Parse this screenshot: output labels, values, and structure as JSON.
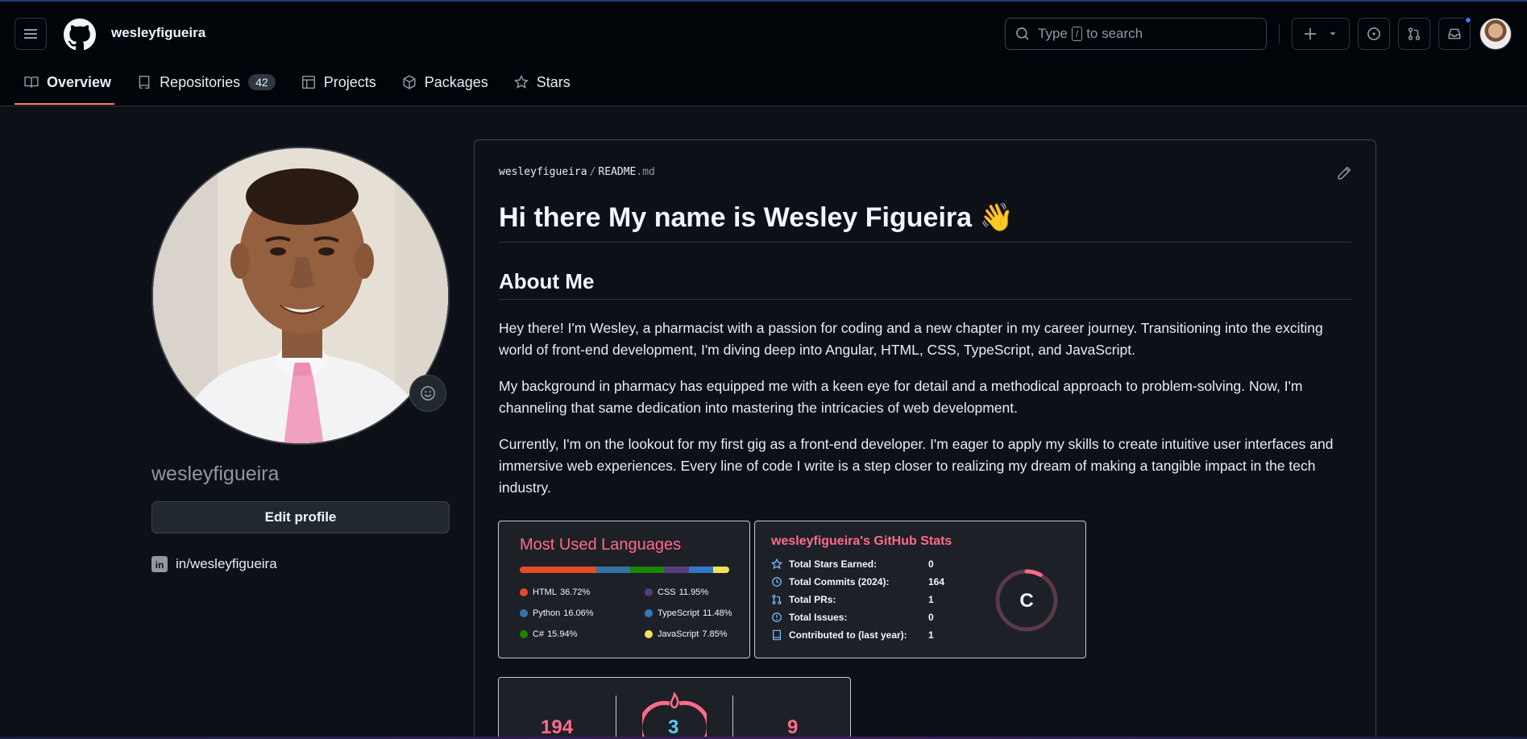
{
  "header": {
    "username": "wesleyfigueira",
    "search_prefix": "Type",
    "search_key": "/",
    "search_suffix": "to search"
  },
  "tabs": [
    {
      "label": "Overview"
    },
    {
      "label": "Repositories",
      "count": "42"
    },
    {
      "label": "Projects"
    },
    {
      "label": "Packages"
    },
    {
      "label": "Stars"
    }
  ],
  "sidebar": {
    "username": "wesleyfigueira",
    "edit_label": "Edit profile",
    "linkedin": "in/wesleyfigueira"
  },
  "readme": {
    "path_user": "wesleyfigueira",
    "path_sep": "/",
    "path_file": "README",
    "path_ext": ".md",
    "title": "Hi there My name is Wesley Figueira",
    "title_emoji": "👋",
    "about_heading": "About Me",
    "paragraphs": [
      "Hey there! I'm Wesley, a pharmacist with a passion for coding and a new chapter in my career journey. Transitioning into the exciting world of front-end development, I'm diving deep into Angular, HTML, CSS, TypeScript, and JavaScript.",
      "My background in pharmacy has equipped me with a keen eye for detail and a methodical approach to problem-solving. Now, I'm channeling that same dedication into mastering the intricacies of web development.",
      "Currently, I'm on the lookout for my first gig as a front-end developer. I'm eager to apply my skills to create intuitive user interfaces and immersive web experiences. Every line of code I write is a step closer to realizing my dream of making a tangible impact in the tech industry."
    ]
  },
  "languages_card": {
    "title": "Most Used Languages",
    "items": [
      {
        "name": "HTML",
        "pct": "36.72%",
        "value": 36.72,
        "color": "#e34c26"
      },
      {
        "name": "Python",
        "pct": "16.06%",
        "value": 16.06,
        "color": "#3572A5"
      },
      {
        "name": "C#",
        "pct": "15.94%",
        "value": 15.94,
        "color": "#178600"
      },
      {
        "name": "CSS",
        "pct": "11.95%",
        "value": 11.95,
        "color": "#563d7c"
      },
      {
        "name": "TypeScript",
        "pct": "11.48%",
        "value": 11.48,
        "color": "#3178c6"
      },
      {
        "name": "JavaScript",
        "pct": "7.85%",
        "value": 7.85,
        "color": "#f1e05a"
      }
    ]
  },
  "stats_card": {
    "title": "wesleyfigueira's GitHub Stats",
    "rows": [
      {
        "label": "Total Stars Earned:",
        "value": "0",
        "icon": "star-icon"
      },
      {
        "label": "Total Commits (2024):",
        "value": "164",
        "icon": "history-icon"
      },
      {
        "label": "Total PRs:",
        "value": "1",
        "icon": "pull-request-icon"
      },
      {
        "label": "Total Issues:",
        "value": "0",
        "icon": "issue-icon"
      },
      {
        "label": "Contributed to (last year):",
        "value": "1",
        "icon": "repo-icon"
      }
    ],
    "grade": "C",
    "grade_progress": 0.08
  },
  "streak_card": {
    "total": "194",
    "current": "3",
    "longest": "9"
  },
  "colors": {
    "accent_pink": "#fe6b8b",
    "tab_underline": "#f78166",
    "background": "#0d1117"
  }
}
